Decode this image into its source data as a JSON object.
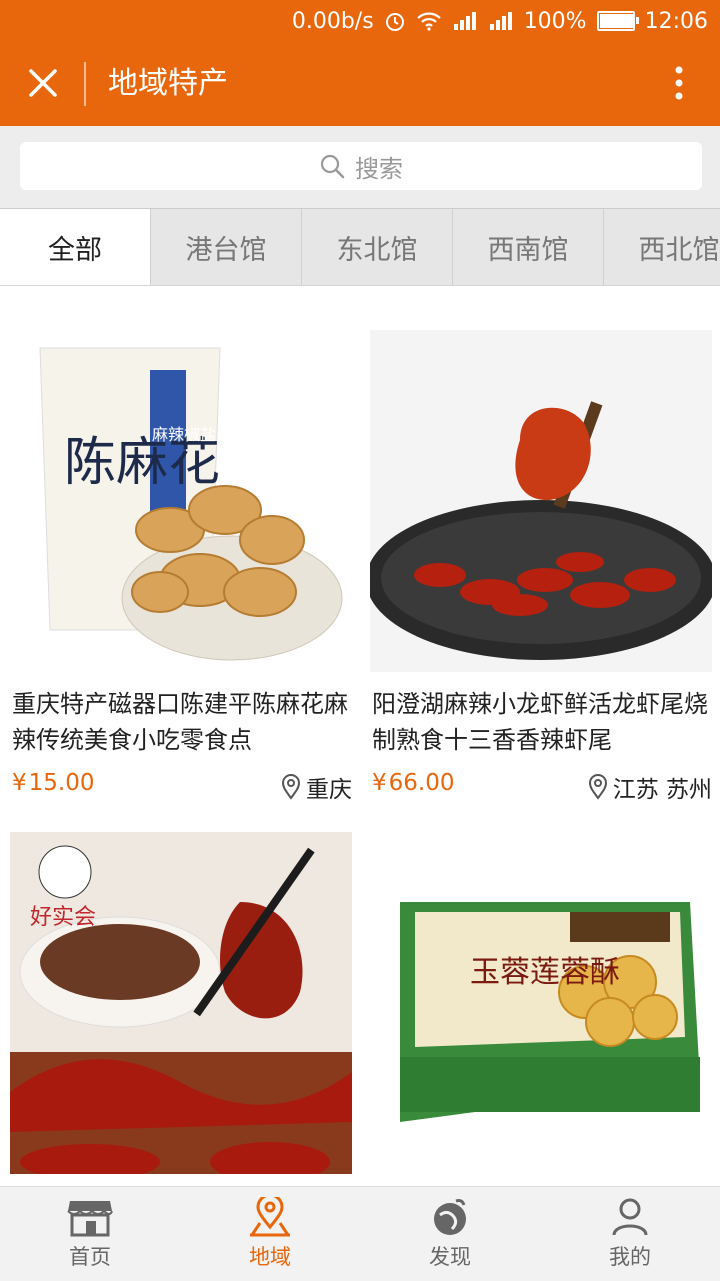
{
  "status_bar": {
    "speed": "0.00b/s",
    "battery": "100%",
    "battery_level": 1.0,
    "time": "12:06"
  },
  "header": {
    "title": "地域特产"
  },
  "search": {
    "placeholder": "搜索"
  },
  "tabs": [
    {
      "label": "全部",
      "active": true
    },
    {
      "label": "港台馆",
      "active": false
    },
    {
      "label": "东北馆",
      "active": false
    },
    {
      "label": "西南馆",
      "active": false
    },
    {
      "label": "西北馆",
      "active": false
    }
  ],
  "products": [
    {
      "name": "重庆特产磁器口陈建平陈麻花麻辣传统美食小吃零食点",
      "price": "15.00",
      "location": "重庆",
      "currency": "¥"
    },
    {
      "name": "阳澄湖麻辣小龙虾鲜活龙虾尾烧制熟食十三香香辣虾尾",
      "price": "66.00",
      "location": "江苏 苏州",
      "currency": "¥"
    },
    {
      "name": "",
      "price": "",
      "location": ""
    },
    {
      "name": "",
      "price": "",
      "location": ""
    }
  ],
  "image_text": {
    "p1_brand": "陈麻花",
    "p1_flavor": "麻辣椒盐",
    "p3_logo": "好实会",
    "p4_title": "玉蓉莲蓉酥"
  },
  "bottom_nav": [
    {
      "label": "首页",
      "icon": "shop-icon",
      "active": false
    },
    {
      "label": "地域",
      "icon": "location-icon",
      "active": true
    },
    {
      "label": "发现",
      "icon": "discover-icon",
      "active": false
    },
    {
      "label": "我的",
      "icon": "user-icon",
      "active": false
    }
  ],
  "colors": {
    "accent": "#e8670d"
  }
}
